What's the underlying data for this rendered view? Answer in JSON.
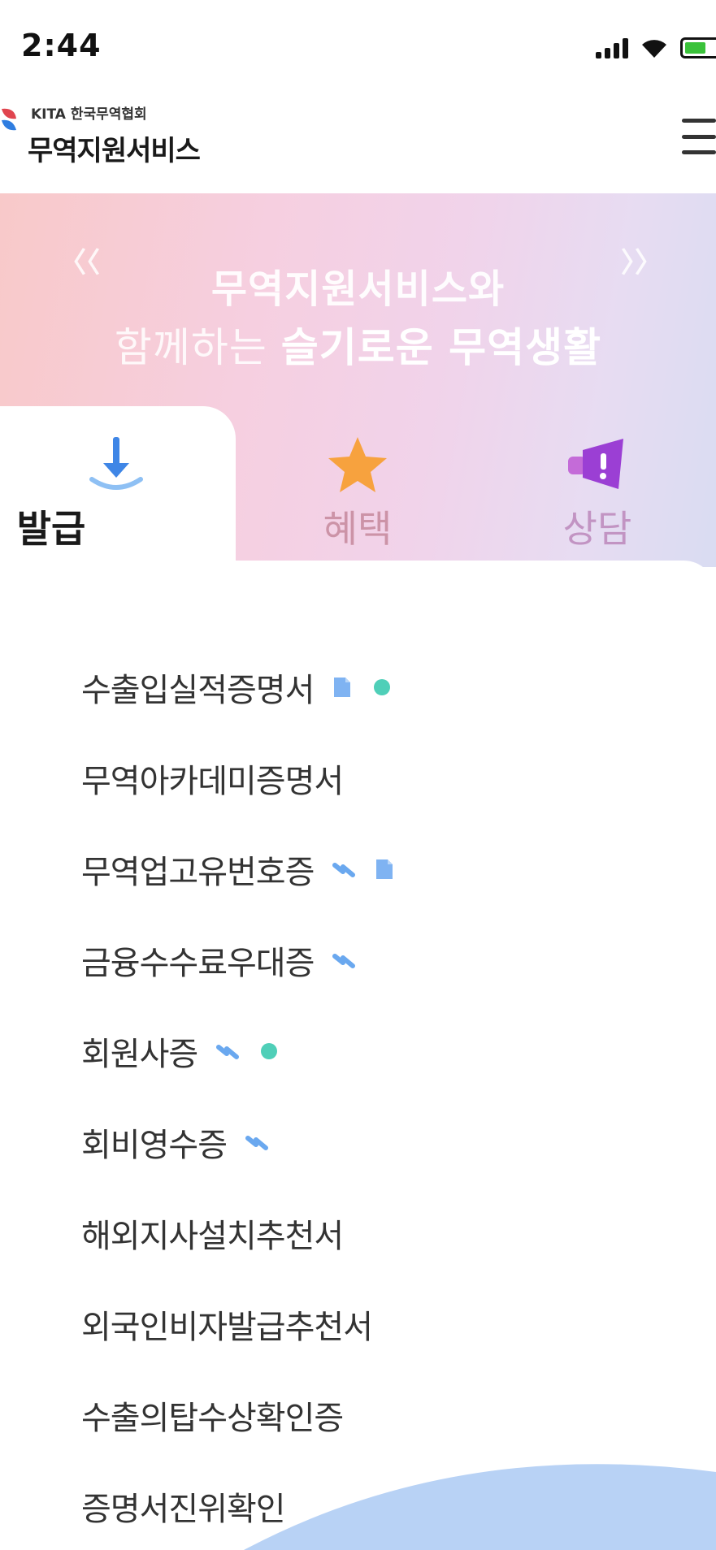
{
  "status_bar": {
    "time": "2:44"
  },
  "header": {
    "logo_sub": "KITA 한국무역협회",
    "logo_title": "무역지원서비스"
  },
  "banner": {
    "prev": "〈〈",
    "next": "〉〉",
    "line1": "무역지원서비스와",
    "line2_plain": "함께하는 ",
    "line2_bold": "슬기로운 무역생활"
  },
  "tabs": [
    {
      "label": "발급",
      "active": true,
      "icon": "download-icon"
    },
    {
      "label": "혜택",
      "active": false,
      "icon": "star-icon"
    },
    {
      "label": "상담",
      "active": false,
      "icon": "megaphone-icon"
    }
  ],
  "certificates": [
    {
      "label": "수출입실적증명서",
      "badges": [
        "document-icon",
        "dot-icon"
      ]
    },
    {
      "label": "무역아카데미증명서",
      "badges": []
    },
    {
      "label": "무역업고유번호증",
      "badges": [
        "link-icon",
        "document-icon"
      ]
    },
    {
      "label": "금융수수료우대증",
      "badges": [
        "link-icon"
      ]
    },
    {
      "label": "회원사증",
      "badges": [
        "link-icon",
        "dot-icon"
      ]
    },
    {
      "label": "회비영수증",
      "badges": [
        "link-icon"
      ]
    },
    {
      "label": "해외지사설치추천서",
      "badges": []
    },
    {
      "label": "외국인비자발급추천서",
      "badges": []
    },
    {
      "label": "수출의탑수상확인증",
      "badges": []
    },
    {
      "label": "증명서진위확인",
      "badges": []
    }
  ],
  "colors": {
    "accent_blue": "#4a90e8",
    "dot_teal": "#4fcfb8",
    "wave_blue": "#b8d2f5"
  }
}
